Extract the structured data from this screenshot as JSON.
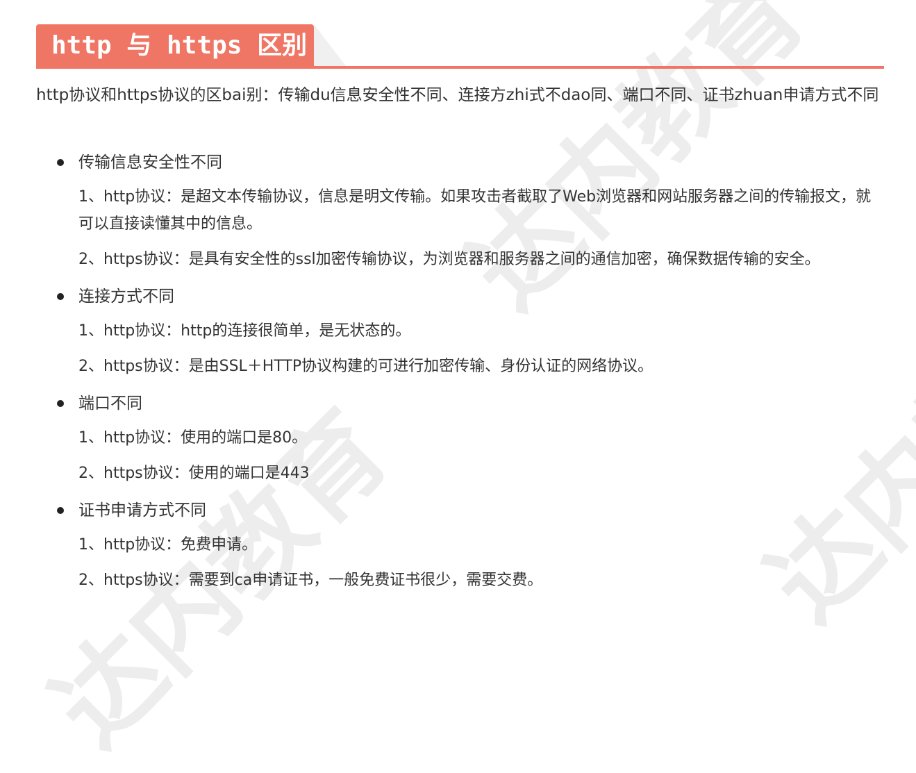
{
  "watermark": "达内教育",
  "heading": "http 与 https 区别",
  "intro": "http协议和https协议的区bai别：传输du信息安全性不同、连接方zhi式不dao同、端口不同、证书zhuan申请方式不同",
  "sections": [
    {
      "title": "传输信息安全性不同",
      "items": [
        "1、http协议：是超文本传输协议，信息是明文传输。如果攻击者截取了Web浏览器和网站服务器之间的传输报文，就可以直接读懂其中的信息。",
        "2、https协议：是具有安全性的ssl加密传输协议，为浏览器和服务器之间的通信加密，确保数据传输的安全。"
      ]
    },
    {
      "title": "连接方式不同",
      "items": [
        "1、http协议：http的连接很简单，是无状态的。",
        "2、https协议：是由SSL＋HTTP协议构建的可进行加密传输、身份认证的网络协议。"
      ]
    },
    {
      "title": "端口不同",
      "items": [
        "1、http协议：使用的端口是80。",
        "2、https协议：使用的端口是443"
      ]
    },
    {
      "title": "证书申请方式不同",
      "items": [
        "1、http协议：免费申请。",
        "2、https协议：需要到ca申请证书，一般免费证书很少，需要交费。"
      ]
    }
  ]
}
